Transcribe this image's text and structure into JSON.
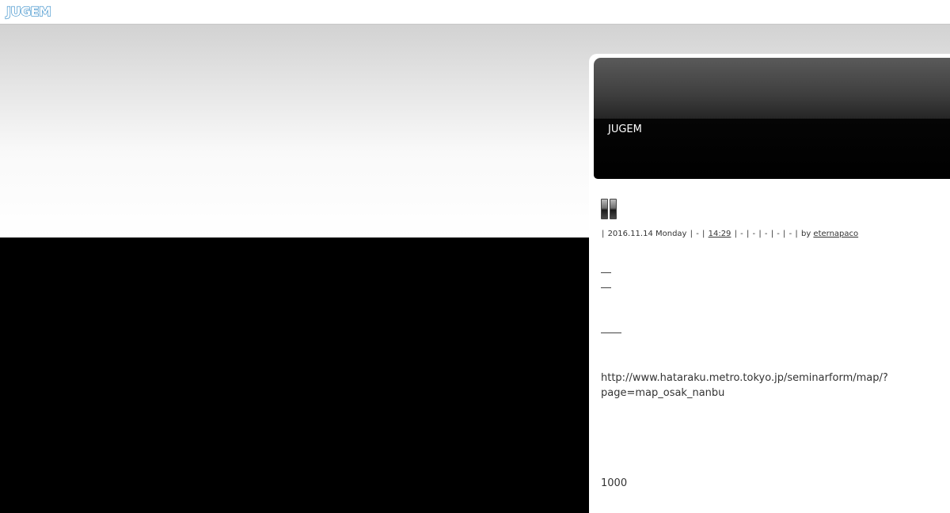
{
  "topbar": {
    "logo_text": "JUGEM",
    "logo_color": "#2a86c6"
  },
  "header": {
    "blog_title": "JUGEM"
  },
  "entry": {
    "title_icon": "double-bar-glyph",
    "meta": {
      "date": "2016.11.14 Monday",
      "category": "-",
      "time": "14:29",
      "comments": "-",
      "trackbacks": "-",
      "field3": "-",
      "field4": "-",
      "field5": "-",
      "by_label": "by",
      "author": "eternapaco"
    },
    "url_text_line1": "http://www.hataraku.metro.tokyo.jp/seminarform/map/?",
    "url_text_line2": "page=map_osak_nanbu",
    "number_text": "1000"
  },
  "colors": {
    "header_bg": "#000000",
    "page_bg_top": "#d2d2d2",
    "page_bg_bottom": "#000000"
  }
}
